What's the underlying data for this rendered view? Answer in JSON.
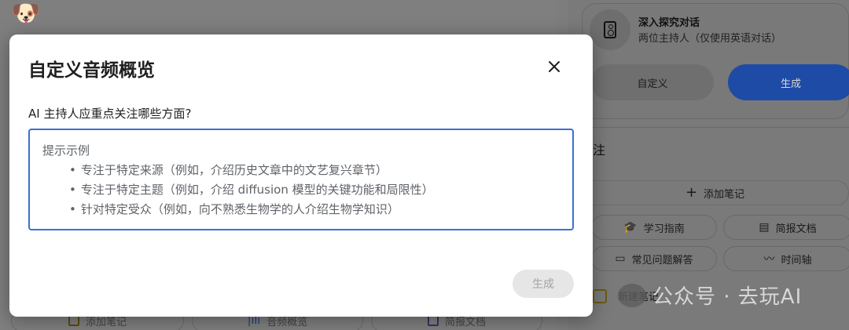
{
  "background": {
    "bottom_chips": [
      "添加笔记",
      "音频概览",
      "简报文档"
    ],
    "audio": {
      "title": "深入探究对话",
      "subtitle": "两位主持人（仅使用英语对话）",
      "customize_label": "自定义",
      "generate_label": "生成"
    },
    "notes": {
      "title_fragment": "注",
      "add_note_label": "添加笔记",
      "chips": [
        "学习指南",
        "简报文档",
        "常见问题解答",
        "时间轴"
      ],
      "new_note_label": "新建笔记"
    },
    "watermark": "公众号 · 去玩AI"
  },
  "modal": {
    "title": "自定义音频概览",
    "question": "AI 主持人应重点关注哪些方面?",
    "prompt_header": "提示示例",
    "prompt_examples": [
      "专注于特定来源（例如，介绍历史文章中的文艺复兴章节）",
      "专注于特定主题（例如，介绍 diffusion 模型的关键功能和局限性）",
      "针对特定受众（例如，向不熟悉生物学的人介绍生物学知识）"
    ],
    "generate_label": "生成"
  },
  "colors": {
    "accent_blue": "#3d6ed6",
    "overlay_gray": "#7d7d7d",
    "disabled_button": "#e6e6e6"
  }
}
